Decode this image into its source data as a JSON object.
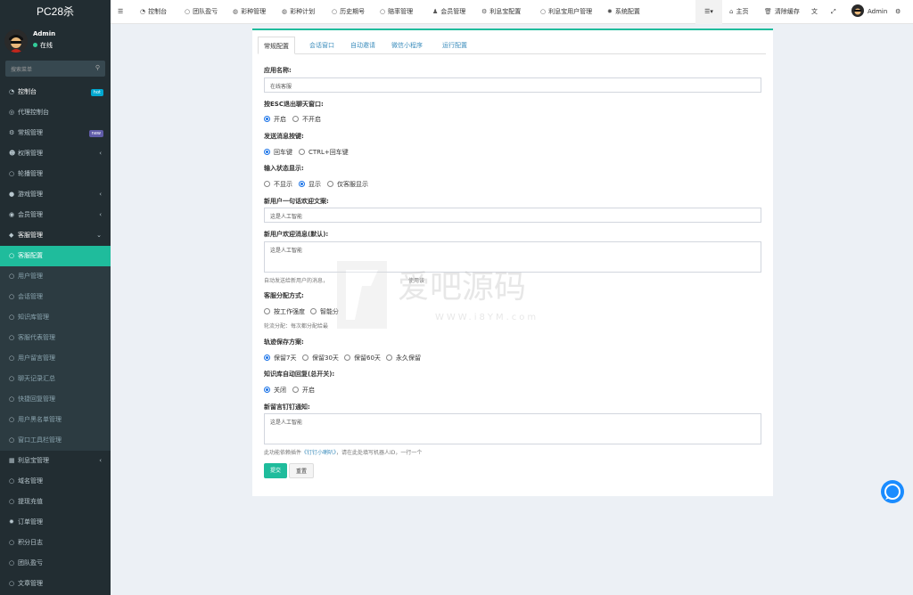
{
  "app": {
    "title": "PC28杀"
  },
  "user": {
    "name": "Admin",
    "status": "在线"
  },
  "search": {
    "placeholder": "搜索菜单"
  },
  "sidebar": {
    "items": [
      {
        "label": "控制台",
        "badge": "hot",
        "badge_color": "#00a7d0"
      },
      {
        "label": "代理控制台"
      },
      {
        "label": "常规管理",
        "badge": "new",
        "badge_color": "#605ca8"
      },
      {
        "label": "权限管理"
      },
      {
        "label": "轮播管理"
      },
      {
        "label": "游戏管理"
      },
      {
        "label": "会员管理"
      },
      {
        "label": "客服管理"
      },
      {
        "label": "客服配置"
      },
      {
        "label": "用户管理"
      },
      {
        "label": "会话管理"
      },
      {
        "label": "知识库管理"
      },
      {
        "label": "客服代表管理"
      },
      {
        "label": "用户留言管理"
      },
      {
        "label": "聊天记录汇总"
      },
      {
        "label": "快捷回复管理"
      },
      {
        "label": "用户黑名单管理"
      },
      {
        "label": "窗口工具栏管理"
      },
      {
        "label": "利息宝管理"
      },
      {
        "label": "域名管理"
      },
      {
        "label": "提现充值"
      },
      {
        "label": "订单管理"
      },
      {
        "label": "积分日志"
      },
      {
        "label": "团队盈亏"
      },
      {
        "label": "文章管理"
      }
    ]
  },
  "topnav": {
    "items": [
      "控制台",
      "团队盈亏",
      "彩种管理",
      "彩种计划",
      "历史期号",
      "赔率管理",
      "会员管理",
      "利息宝配置",
      "利息宝用户管理",
      "系统配置"
    ],
    "home": "主页",
    "clear_cache": "清除缓存",
    "admin": "Admin"
  },
  "tabs": [
    "常规配置",
    "会话窗口",
    "自动邀请",
    "微信小程序",
    "运行配置"
  ],
  "form": {
    "app_name_label": "应用名称:",
    "app_name_value": "在线客服",
    "esc_label": "按ESC退出聊天窗口:",
    "esc_on": "开启",
    "esc_off": "不开启",
    "send_key_label": "发送消息按键:",
    "send_key_enter": "回车键",
    "send_key_ctrl": "CTRL+回车键",
    "typing_label": "输入状态显示:",
    "typing_hide": "不显示",
    "typing_show": "显示",
    "typing_agent": "仅客服显示",
    "welcome_label": "新用户一句话欢迎文案:",
    "welcome_value": "这是人工智能",
    "welcome_msg_label": "新用户欢迎消息(默认):",
    "welcome_msg_value": "这是人工智能",
    "welcome_help_a": "自动发送给新用户的消息，",
    "welcome_help_b": "使用该",
    "alloc_label": "客服分配方式:",
    "alloc_load": "按工作强度",
    "alloc_smart": "智能分",
    "alloc_help": "轮流分配：每次都分配给最",
    "track_label": "轨迹保存方案:",
    "track_7": "保留7天",
    "track_30": "保留30天",
    "track_60": "保留60天",
    "track_forever": "永久保留",
    "kb_label": "知识库自动回复(总开关):",
    "kb_off": "关闭",
    "kb_on": "开启",
    "ding_label": "新留言钉钉通知:",
    "ding_value": "这是人工智能",
    "ding_help_a": "此功能依赖插件",
    "ding_help_link": "《钉钉小喇叭》",
    "ding_help_b": "，请在此处填写机器人ID，一行一个",
    "submit": "提交",
    "reset": "重置"
  },
  "watermark": {
    "text": "爱吧源码",
    "url": "WWW.i8YM.com"
  },
  "colors": {
    "accent": "#1fbc9c",
    "sidebar": "#222d32",
    "link": "#3c8dbc"
  }
}
